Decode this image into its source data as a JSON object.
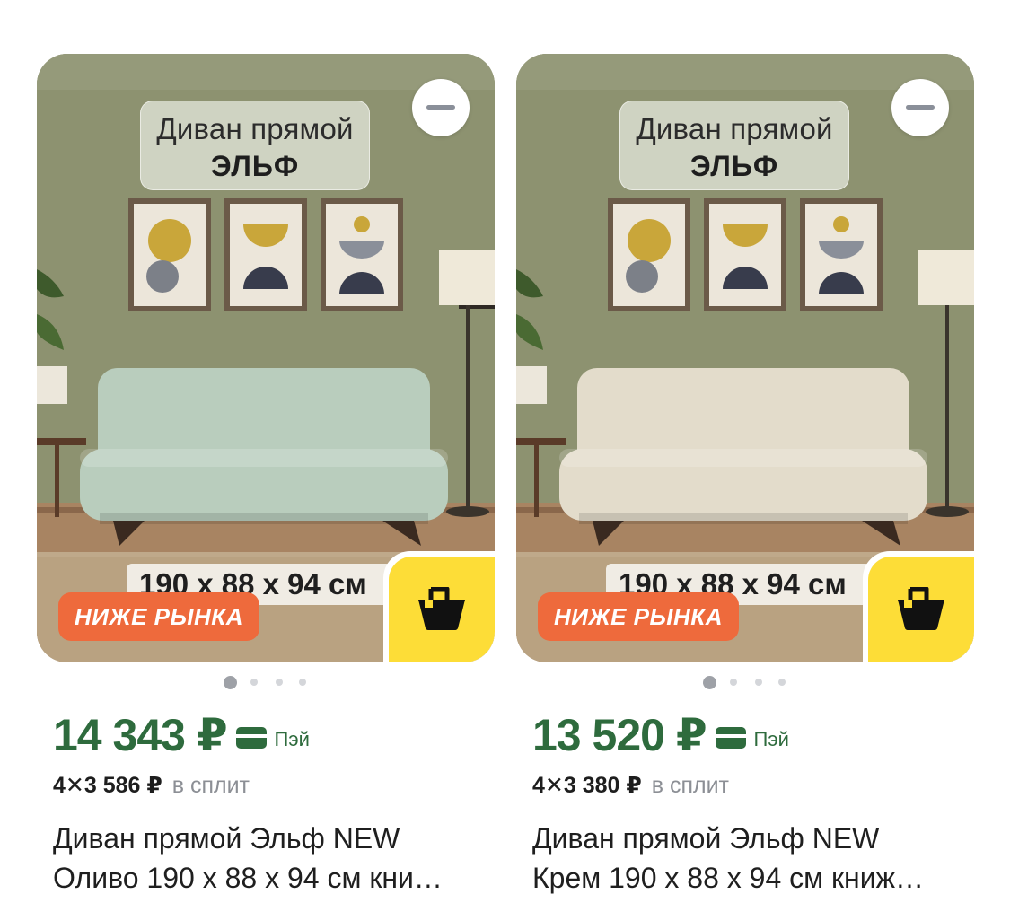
{
  "products": [
    {
      "photo_title_line1": "Диван прямой",
      "photo_title_line2": "ЭЛЬФ",
      "photo_size_text": "190 x 88 x 94 см",
      "badge": "НИЖЕ РЫНКА",
      "sofa_color": "#b9cdbd",
      "price": "14 343 ₽",
      "pay_label": "Пэй",
      "split_amount": "4✕3 586 ₽",
      "split_label": "в сплит",
      "name_line1": "Диван прямой Эльф NEW",
      "name_line2": "Оливо 190 х 88 х 94 см кни…",
      "gallery_dots": 4,
      "active_dot": 0,
      "icons": {
        "remove": "minus-icon",
        "cart": "basket-icon",
        "pay": "card-icon"
      }
    },
    {
      "photo_title_line1": "Диван прямой",
      "photo_title_line2": "ЭЛЬФ",
      "photo_size_text": "190 x 88 x 94 см",
      "badge": "НИЖЕ РЫНКА",
      "sofa_color": "#e3dccb",
      "price": "13 520 ₽",
      "pay_label": "Пэй",
      "split_amount": "4✕3 380 ₽",
      "split_label": "в сплит",
      "name_line1": "Диван прямой Эльф NEW",
      "name_line2": "Крем 190 х 88 х 94 см книж…",
      "gallery_dots": 4,
      "active_dot": 0,
      "icons": {
        "remove": "minus-icon",
        "cart": "basket-icon",
        "pay": "card-icon"
      }
    }
  ],
  "colors": {
    "price_green": "#2e6b3d",
    "badge_orange": "#ee6a3c",
    "cart_yellow": "#fddd37"
  }
}
